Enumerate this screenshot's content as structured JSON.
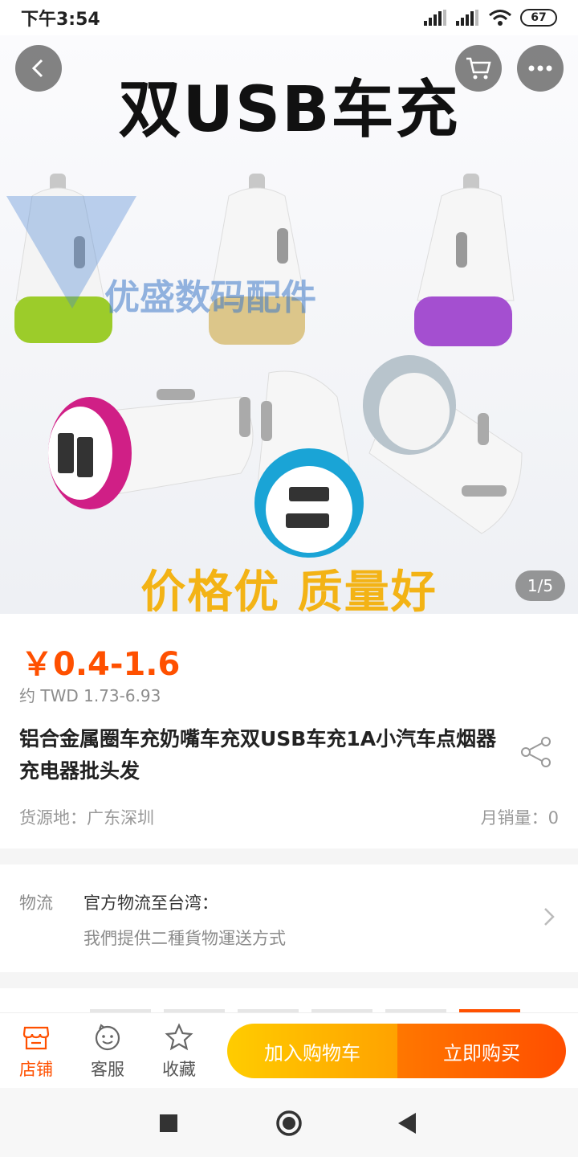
{
  "status_bar": {
    "time": "下午3:54",
    "battery": "67"
  },
  "gallery": {
    "headline": "双USB车充",
    "watermark": "优盛数码配件",
    "tagline": "价格优 质量好",
    "counter": "1/5"
  },
  "product": {
    "price": "￥0.4-1.6",
    "price_local": "约 TWD 1.73-6.93",
    "title": "铝合金属圈车充奶嘴车充双USB车充1A小汽车点烟器充电器批头发",
    "origin": "货源地：广东深圳",
    "sales": "月销量：0"
  },
  "logistics": {
    "label": "物流",
    "main": "官方物流至台湾：",
    "sub": "我們提供二種貨物運送方式"
  },
  "action_bar": {
    "store_label": "店铺",
    "service_label": "客服",
    "favorite_label": "收藏",
    "add_cart_label": "加入购物车",
    "buy_now_label": "立即购买"
  },
  "colors": {
    "accent": "#ff5000",
    "cart_button": "#ffb000",
    "buy_button": "#ff5a00"
  },
  "icons": [
    "back-icon",
    "cart-icon",
    "more-icon",
    "share-icon",
    "chevron-right-icon",
    "store-icon",
    "service-icon",
    "star-icon"
  ]
}
